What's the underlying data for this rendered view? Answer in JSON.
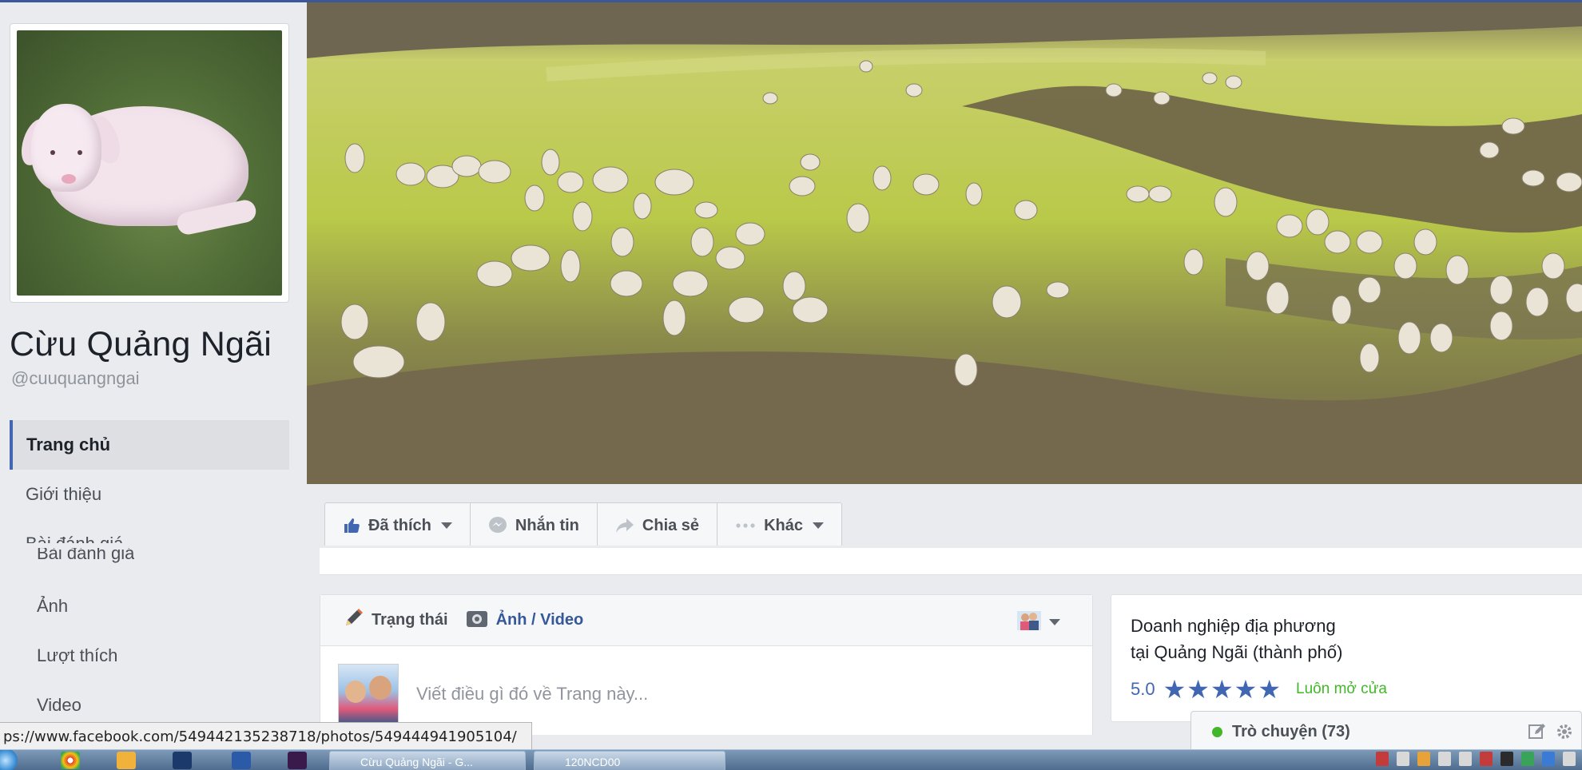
{
  "page": {
    "name": "Cừu Quảng Ngãi",
    "handle": "@cuuquangngai"
  },
  "nav": {
    "items": [
      "Trang chủ",
      "Giới thiệu",
      "Bài đánh giá",
      "Ảnh",
      "Lượt thích",
      "Video"
    ],
    "active": "Trang chủ"
  },
  "actions": {
    "liked": "Đã thích",
    "message": "Nhắn tin",
    "share": "Chia sẻ",
    "more": "Khác"
  },
  "composer": {
    "tab_status": "Trạng thái",
    "tab_photo": "Ảnh / Video",
    "placeholder": "Viết điều gì đó về Trang này..."
  },
  "about": {
    "category_line1": "Doanh nghiệp địa phương",
    "category_line2": "tại Quảng Ngãi (thành phố)",
    "rating": "5.0",
    "stars": "★★★★★",
    "open_status": "Luôn mở cửa"
  },
  "chat": {
    "label": "Trò chuyện (73)"
  },
  "browser": {
    "status_url": "ps://www.facebook.com/549442135238718/photos/549444941905104/"
  },
  "taskbar": {
    "task1": "Cừu Quảng Ngãi - G...",
    "task2": "120NCD00"
  },
  "colors": {
    "facebook_blue": "#4267b2",
    "nav_active_bg": "#dddfe2",
    "page_bg": "#e9ebee",
    "online_green": "#42b72a"
  }
}
